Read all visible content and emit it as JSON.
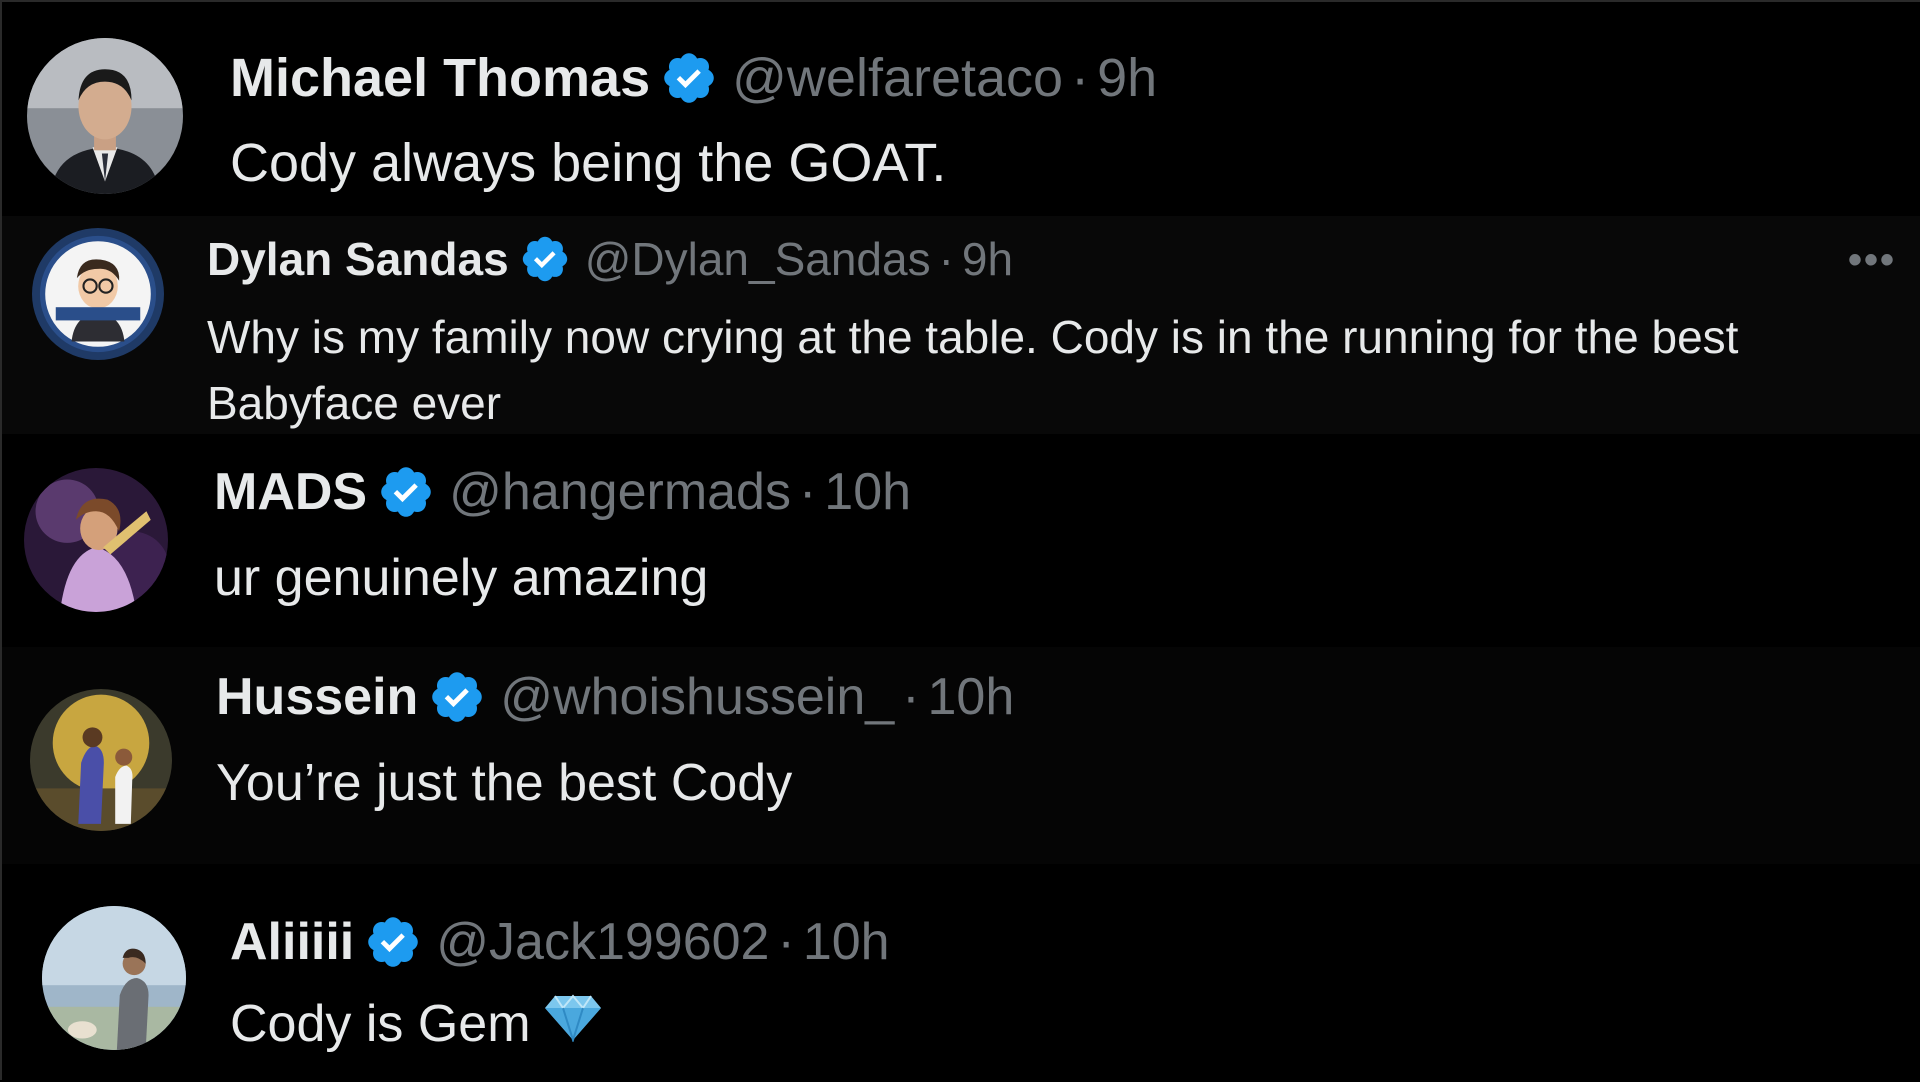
{
  "colors": {
    "background": "#000000",
    "text": "#e7e9ea",
    "muted": "#71767b",
    "verified": "#1d9bf0"
  },
  "tweets": [
    {
      "name": "Michael Thomas",
      "handle": "@welfaretaco",
      "separator": "·",
      "time": "9h",
      "text": "Cody always being the GOAT.",
      "avatar_icon": "man-in-suit-avatar",
      "verified_icon": "verified-badge-icon"
    },
    {
      "name": "Dylan Sandas",
      "handle": "@Dylan_Sandas",
      "separator": "·",
      "time": "9h",
      "text": "Why is my family now crying at the table. Cody is in the running for the best",
      "text2": "Babyface ever",
      "more": "•••",
      "avatar_icon": "cartoon-avatar",
      "verified_icon": "verified-badge-icon"
    },
    {
      "name": "MADS",
      "handle": "@hangermads",
      "separator": "·",
      "time": "10h",
      "text": "ur genuinely amazing",
      "avatar_icon": "wrestler-avatar",
      "verified_icon": "verified-badge-icon"
    },
    {
      "name": "Hussein",
      "handle": "@whoishussein_",
      "separator": "·",
      "time": "10h",
      "text": "You’re just the best Cody",
      "avatar_icon": "basketball-players-avatar",
      "verified_icon": "verified-badge-icon"
    },
    {
      "name": "Aliiiii",
      "handle": "@Jack199602",
      "separator": "·",
      "time": "10h",
      "text": "Cody is Gem",
      "emoji_icon": "gem-icon",
      "avatar_icon": "man-outdoors-avatar",
      "verified_icon": "verified-badge-icon"
    }
  ]
}
